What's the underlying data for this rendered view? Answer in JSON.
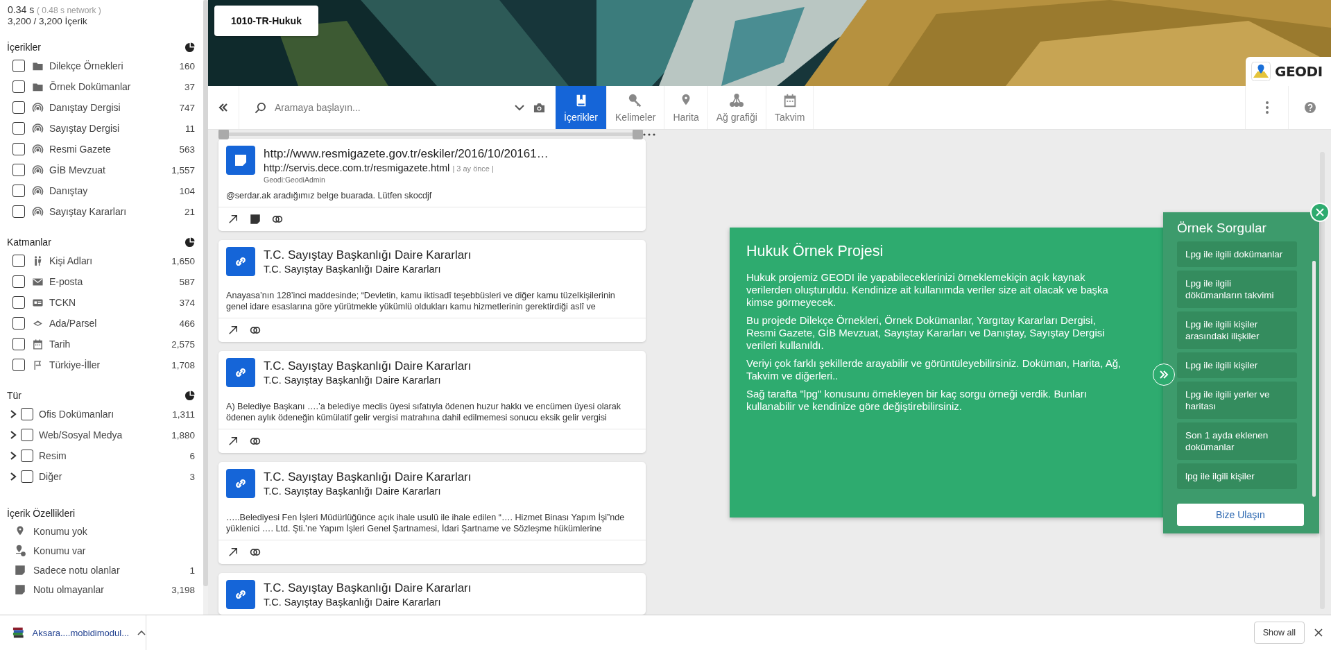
{
  "stats": {
    "time": "0.34 s",
    "network": "( 0.48 s network )",
    "count": "3,200 / 3,200 İçerik"
  },
  "facets": [
    {
      "title": "İçerikler",
      "items": [
        {
          "kind": "folder",
          "label": "Dilekçe Örnekleri",
          "count": "160",
          "checked": false
        },
        {
          "kind": "folder",
          "label": "Örnek Dokümanlar",
          "count": "37",
          "checked": false
        },
        {
          "kind": "feed",
          "label": "Danıştay Dergisi",
          "count": "747",
          "checked": false
        },
        {
          "kind": "feed",
          "label": "Sayıştay Dergisi",
          "count": "11",
          "checked": false
        },
        {
          "kind": "feed",
          "label": "Resmi Gazete",
          "count": "563",
          "checked": false
        },
        {
          "kind": "feed",
          "label": "GİB Mevzuat",
          "count": "1,557",
          "checked": false
        },
        {
          "kind": "feed",
          "label": "Danıştay",
          "count": "104",
          "checked": false
        },
        {
          "kind": "feed",
          "label": "Sayıştay Kararları",
          "count": "21",
          "checked": false
        }
      ]
    },
    {
      "title": "Katmanlar",
      "items": [
        {
          "kind": "people",
          "label": "Kişi Adları",
          "count": "1,650",
          "checked": false
        },
        {
          "kind": "mail",
          "label": "E-posta",
          "count": "587",
          "checked": false
        },
        {
          "kind": "idcard",
          "label": "TCKN",
          "count": "374",
          "checked": false
        },
        {
          "kind": "parcel",
          "label": "Ada/Parsel",
          "count": "466",
          "checked": false
        },
        {
          "kind": "calendar",
          "label": "Tarih",
          "count": "2,575",
          "checked": false
        },
        {
          "kind": "flag",
          "label": "Türkiye-İller",
          "count": "1,708",
          "checked": false
        }
      ]
    },
    {
      "title": "Tür",
      "items": [
        {
          "kind": "tree",
          "label": "Ofis Dokümanları",
          "count": "1,311",
          "checked": false,
          "expanded": false
        },
        {
          "kind": "tree",
          "label": "Web/Sosyal Medya",
          "count": "1,880",
          "checked": false,
          "expanded": false
        },
        {
          "kind": "tree",
          "label": "Resim",
          "count": "6",
          "checked": false,
          "expanded": false
        },
        {
          "kind": "tree",
          "label": "Diğer",
          "count": "3",
          "checked": false,
          "expanded": false
        }
      ]
    }
  ],
  "properties": {
    "title": "İçerik Özellikleri",
    "items": [
      {
        "kind": "pin",
        "label": "Konumu yok"
      },
      {
        "kind": "pin-dot",
        "label": "Konumu var"
      },
      {
        "kind": "note",
        "label": "Sadece notu olanlar",
        "count": "1"
      },
      {
        "kind": "note",
        "label": "Notu olmayanlar",
        "count": "3,198"
      }
    ]
  },
  "project_button": "1010-TR-Hukuk",
  "logo": "GEODI",
  "search": {
    "placeholder": "Aramaya başlayın..."
  },
  "tabs": [
    {
      "kind": "book",
      "label": "İçerikler",
      "selected": true
    },
    {
      "kind": "key",
      "label": "Kelimeler",
      "selected": false
    },
    {
      "kind": "pin",
      "label": "Harita",
      "selected": false
    },
    {
      "kind": "graph",
      "label": "Ağ grafiği",
      "selected": false
    },
    {
      "kind": "calendar",
      "label": "Takvim",
      "selected": false
    }
  ],
  "timeline": {
    "level": 1
  },
  "results": [
    {
      "kind": "note",
      "title": "http://www.resmigazete.gov.tr/eskiler/2016/10/20161…",
      "subtitle": "http://servis.dece.com.tr/resmigazete.html",
      "meta": "| 3 ay önce |",
      "author": "Geodi:GeodiAdmin",
      "snippet": "@serdar.ak aradığımız belge buarada. Lütfen skocdjf",
      "actions": [
        {
          "kind": "open"
        },
        {
          "kind": "note"
        },
        {
          "kind": "related"
        }
      ]
    },
    {
      "kind": "link",
      "title": "T.C. Sayıştay Başkanlığı Daire Kararları",
      "subtitle": "T.C. Sayıştay Başkanlığı Daire Kararları",
      "snippet": "Anayasa’nın 128’inci maddesinde; “Devletin, kamu iktisadî teşebbüsleri ve diğer kamu tüzelkişilerinin genel idare esaslarına göre yürütmekle yükümlü oldukları kamu hizmetlerinin gerektirdiği aslî ve",
      "actions": [
        {
          "kind": "open"
        },
        {
          "kind": "related"
        }
      ]
    },
    {
      "kind": "link",
      "title": "T.C. Sayıştay Başkanlığı Daire Kararları",
      "subtitle": "T.C. Sayıştay Başkanlığı Daire Kararları",
      "snippet": "A) Belediye Başkanı ….’a belediye meclis üyesi sıfatıyla ödenen huzur hakkı ve encümen üyesi olarak ödenen aylık ödeneğin kümülatif gelir vergisi matrahına dahil edilmemesi sonucu eksik gelir vergisi",
      "actions": [
        {
          "kind": "open"
        },
        {
          "kind": "related"
        }
      ]
    },
    {
      "kind": "link",
      "title": "T.C. Sayıştay Başkanlığı Daire Kararları",
      "subtitle": "T.C. Sayıştay Başkanlığı Daire Kararları",
      "snippet": "…..Belediyesi Fen İşleri Müdürlüğünce açık ihale usulü ile ihale edilen “…. Hizmet Binası Yapım İşi”nde yüklenici …. Ltd. Şti.’ne Yapım İşleri Genel Şartnamesi, İdari Şartname ve Sözleşme hükümlerine",
      "actions": [
        {
          "kind": "open"
        },
        {
          "kind": "related"
        }
      ]
    },
    {
      "kind": "link",
      "title": "T.C. Sayıştay Başkanlığı Daire Kararları",
      "subtitle": "T.C. Sayıştay Başkanlığı Daire Kararları"
    }
  ],
  "info": {
    "title": "Hukuk Örnek Projesi",
    "paragraphs": [
      "Hukuk projemiz GEODI ile yapabileceklerinizi örneklemekiçin açık kaynak verilerden oluşturuldu. Kendinize ait kullanımda veriler size ait olacak ve başka kimse görmeyecek.",
      "Bu projede Dilekçe Örnekleri, Örnek Dokümanlar, Yargıtay Kararları Dergisi, Resmi Gazete, GİB Mevzuat, Sayıştay Kararları ve Danıştay, Sayıştay Dergisi verileri kullanıldı.",
      "Veriyi çok farklı şekillerde arayabilir ve görüntüleyebilirsiniz. Doküman, Harita, Ağ, Takvim ve diğerleri..",
      "Sağ tarafta \"lpg\" konusunu örnekleyen bir kaç sorgu örneği verdik. Bunları kullanabilir ve kendinize göre değiştirebilirsiniz."
    ]
  },
  "samples": {
    "title": "Örnek Sorgular",
    "queries": [
      "Lpg ile ilgili dokümanlar",
      "Lpg ile ilgili dökümanların takvimi",
      "Lpg ile ilgili kişiler arasındaki ilişkiler",
      "Lpg ile ilgili kişiler",
      "Lpg ile ilgili yerler ve haritası",
      "Son 1 ayda eklenen dokümanlar",
      "lpg ile ilgili kişiler"
    ],
    "contact": "Bize Ulaşın"
  },
  "download": {
    "file": "Aksara....mobidimodul...",
    "show_all": "Show all"
  }
}
